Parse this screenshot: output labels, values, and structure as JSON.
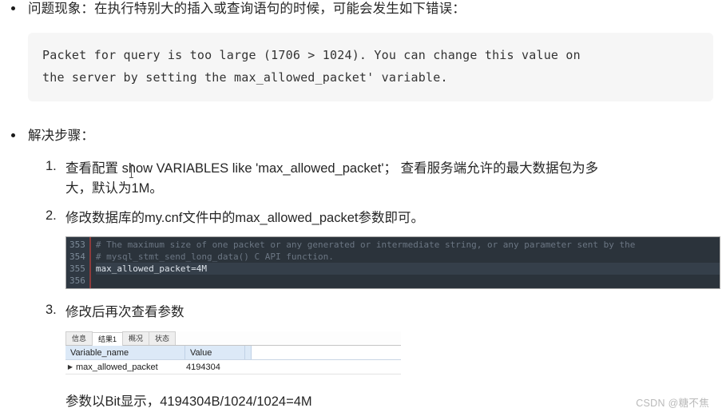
{
  "document": {
    "bullets": [
      {
        "id": "problem",
        "text": "问题现象：在执行特别大的插入或查询语句的时候，可能会发生如下错误："
      },
      {
        "id": "solution",
        "text": "解决步骤："
      }
    ],
    "error_block": {
      "line1": "Packet for query is too large (1706 > 1024). You can change this value on",
      "line2": "the server by setting the max_allowed_packet' variable.",
      "background": "#f6f6f6"
    },
    "steps": [
      {
        "number": "1.",
        "line1": "查看配置 show VARIABLES like 'max_allowed_packet'；  查看服务端允许的最大数据包为多",
        "line2": "大，默认为1M。"
      },
      {
        "number": "2.",
        "line1": "修改数据库的my.cnf文件中的max_allowed_packet参数即可。",
        "line2": ""
      },
      {
        "number": "3.",
        "line1": "修改后再次查看参数",
        "line2": ""
      }
    ],
    "editor_screenshot": {
      "background": "#2b333b",
      "gutter_background": "#2f3842",
      "marker_color": "#8e3b3b",
      "lines": [
        {
          "number": "353",
          "code": "# The maximum size of one packet or any generated or intermediate string, or any parameter sent by the",
          "type": "comment"
        },
        {
          "number": "354",
          "code": "# mysql_stmt_send_long_data() C API function.",
          "type": "comment"
        },
        {
          "number": "355",
          "code": "max_allowed_packet=4M",
          "type": "active"
        },
        {
          "number": "356",
          "code": "",
          "type": "blank"
        }
      ]
    },
    "result_grid": {
      "tabs": [
        {
          "label": "信息",
          "active": false
        },
        {
          "label": "结果1",
          "active": true
        },
        {
          "label": "概况",
          "active": false
        },
        {
          "label": "状态",
          "active": false
        }
      ],
      "columns": [
        "Variable_name",
        "Value"
      ],
      "rows": [
        {
          "marker": "▶",
          "name": "max_allowed_packet",
          "value": "4194304"
        }
      ],
      "header_background": "#dce9f7"
    },
    "caption": "参数以Bit显示，4194304B/1024/1024=4M",
    "watermark": "CSDN @糖不焦"
  }
}
